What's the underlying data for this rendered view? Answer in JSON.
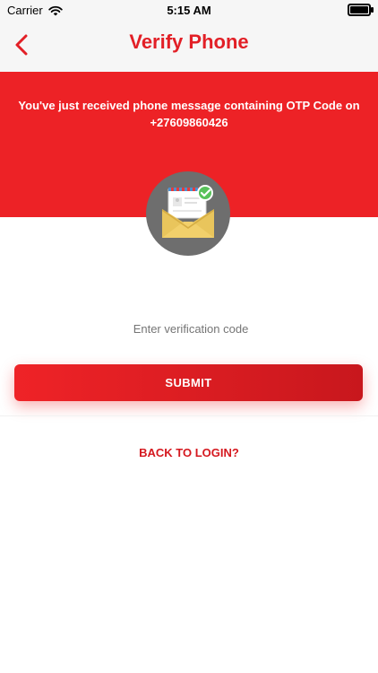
{
  "status_bar": {
    "carrier": "Carrier",
    "time": "5:15 AM"
  },
  "nav": {
    "title": "Verify Phone",
    "back_icon": "chevron-left-icon"
  },
  "hero": {
    "message_line1": "You've just received phone message containing OTP Code on",
    "phone_number": "+27609860426"
  },
  "illustration": {
    "icon": "envelope-check-icon"
  },
  "form": {
    "code_placeholder": "Enter verification code",
    "submit_label": "SUBMIT"
  },
  "links": {
    "back_to_login": "BACK TO LOGIN?"
  },
  "colors": {
    "brand_red": "#ED2226",
    "title_red": "#E21F26",
    "placeholder_gray": "#B5B5B5"
  }
}
